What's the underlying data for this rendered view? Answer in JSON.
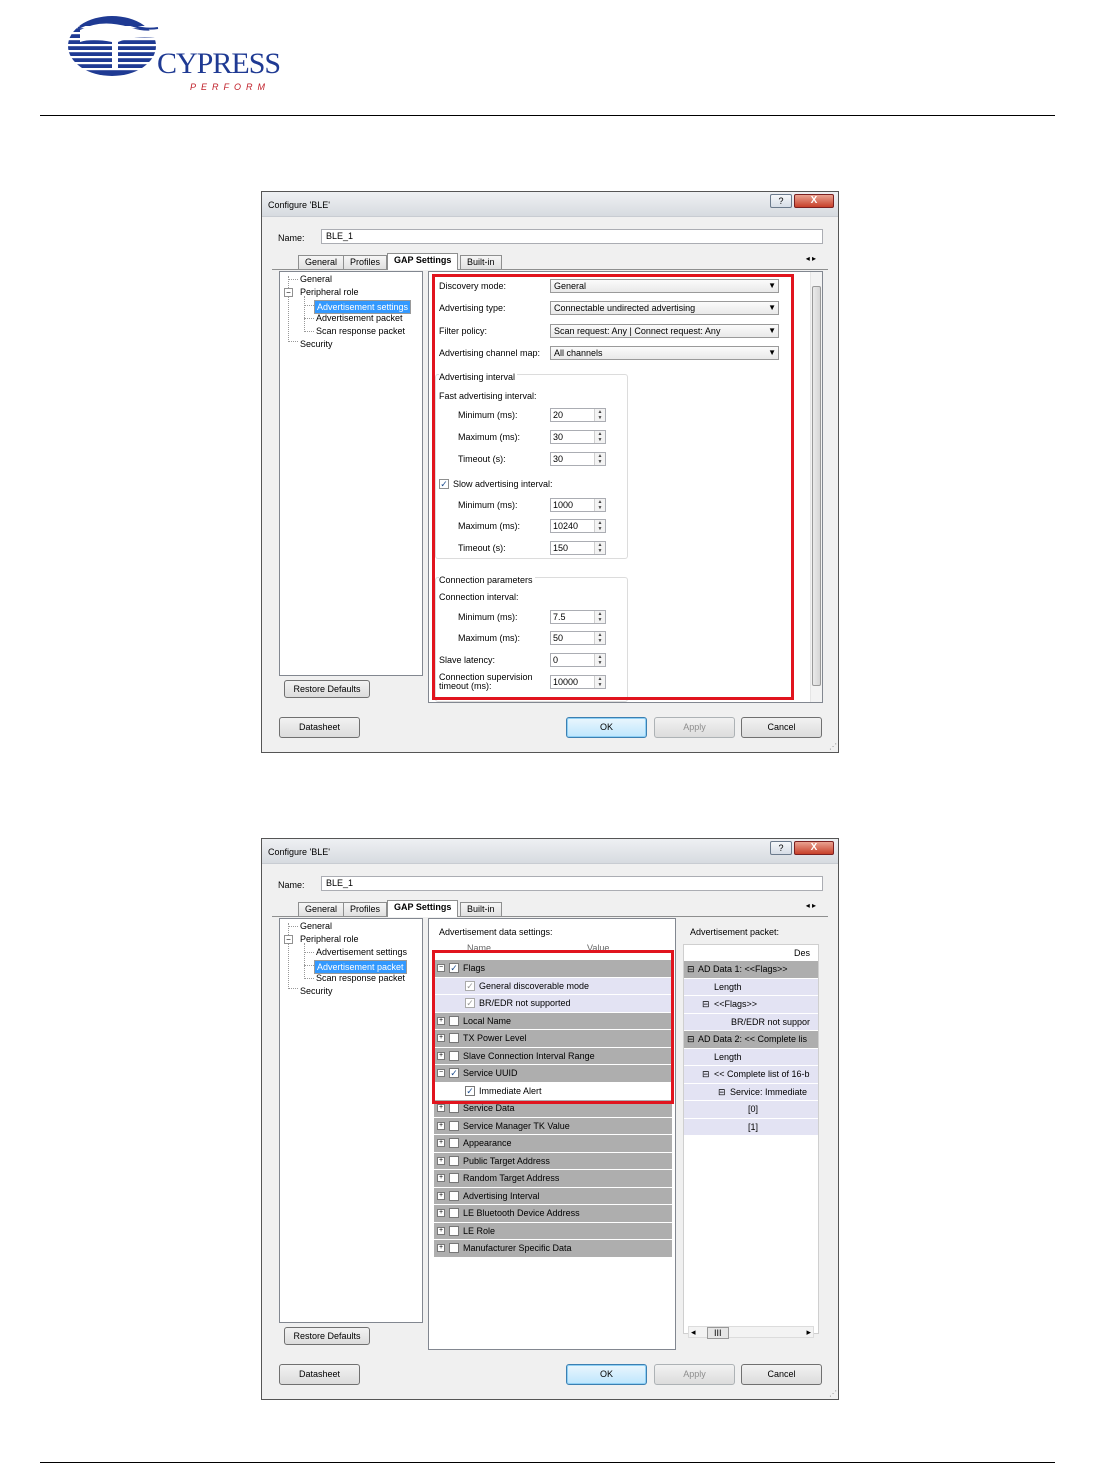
{
  "logo": {
    "name": "CYPRESS",
    "tagline": "PERFORM"
  },
  "dialog1": {
    "title": "Configure 'BLE'",
    "help_label": "?",
    "close_label": "X",
    "name_label": "Name:",
    "name_value": "BLE_1",
    "tabs": [
      "General",
      "Profiles",
      "GAP Settings",
      "Built-in"
    ],
    "tab_arrows": "◂ ▸",
    "tree": [
      "General",
      "Peripheral role",
      "Advertisement settings",
      "Advertisement packet",
      "Scan response packet",
      "Security"
    ],
    "fields": {
      "discovery_mode": {
        "label": "Discovery mode:",
        "value": "General"
      },
      "advertising_type": {
        "label": "Advertising type:",
        "value": "Connectable undirected advertising"
      },
      "filter_policy": {
        "label": "Filter policy:",
        "value": "Scan request: Any | Connect request: Any"
      },
      "channel_map": {
        "label": "Advertising channel map:",
        "value": "All channels"
      }
    },
    "adv_interval": {
      "group": "Advertising interval",
      "fast": "Fast advertising interval:",
      "fast_min": {
        "label": "Minimum (ms):",
        "value": "20"
      },
      "fast_max": {
        "label": "Maximum (ms):",
        "value": "30"
      },
      "fast_timeout": {
        "label": "Timeout (s):",
        "value": "30"
      },
      "slow": "Slow advertising interval:",
      "slow_checked": "✓",
      "slow_min": {
        "label": "Minimum (ms):",
        "value": "1000"
      },
      "slow_max": {
        "label": "Maximum (ms):",
        "value": "10240"
      },
      "slow_timeout": {
        "label": "Timeout (s):",
        "value": "150"
      }
    },
    "conn": {
      "group": "Connection parameters",
      "interval": "Connection interval:",
      "min": {
        "label": "Minimum (ms):",
        "value": "7.5"
      },
      "max": {
        "label": "Maximum (ms):",
        "value": "50"
      },
      "latency": {
        "label": "Slave latency:",
        "value": "0"
      },
      "timeout": {
        "label": "Connection supervision timeout (ms):",
        "value": "10000"
      }
    },
    "buttons": {
      "restore": "Restore Defaults",
      "datasheet": "Datasheet",
      "ok": "OK",
      "apply": "Apply",
      "cancel": "Cancel"
    }
  },
  "dialog2": {
    "title": "Configure 'BLE'",
    "help_label": "?",
    "close_label": "X",
    "name_label": "Name:",
    "name_value": "BLE_1",
    "tabs": [
      "General",
      "Profiles",
      "GAP Settings",
      "Built-in"
    ],
    "tab_arrows": "◂ ▸",
    "tree": [
      "General",
      "Peripheral role",
      "Advertisement settings",
      "Advertisement packet",
      "Scan response packet",
      "Security"
    ],
    "ad_settings_label": "Advertisement data settings:",
    "col_name": "Name",
    "col_value": "Value",
    "rows": [
      {
        "label": "Flags",
        "expander": "−",
        "checked": "✓"
      },
      {
        "label": "General discoverable mode",
        "checked": "✓"
      },
      {
        "label": "BR/EDR not supported",
        "checked": "✓"
      },
      {
        "label": "Local Name",
        "expander": "+",
        "checked": ""
      },
      {
        "label": "TX Power Level",
        "expander": "+",
        "checked": ""
      },
      {
        "label": "Slave Connection Interval Range",
        "expander": "+",
        "checked": ""
      },
      {
        "label": "Service UUID",
        "expander": "−",
        "checked": "✓"
      },
      {
        "label": "Immediate Alert",
        "checked": "✓"
      },
      {
        "label": "Service Data",
        "expander": "+",
        "checked": ""
      },
      {
        "label": "Service Manager TK Value",
        "expander": "+",
        "checked": ""
      },
      {
        "label": "Appearance",
        "expander": "+",
        "checked": ""
      },
      {
        "label": "Public Target Address",
        "expander": "+",
        "checked": ""
      },
      {
        "label": "Random Target Address",
        "expander": "+",
        "checked": ""
      },
      {
        "label": "Advertising Interval",
        "expander": "+",
        "checked": ""
      },
      {
        "label": "LE Bluetooth Device Address",
        "expander": "+",
        "checked": ""
      },
      {
        "label": "LE Role",
        "expander": "+",
        "checked": ""
      },
      {
        "label": "Manufacturer Specific Data",
        "expander": "+",
        "checked": ""
      }
    ],
    "packet_label": "Advertisement packet:",
    "packet_col": "Des",
    "packet_rows": [
      "AD Data 1: <<Flags>>",
      "Length",
      "<<Flags>>",
      "BR/EDR not suppor",
      "AD Data 2: << Complete lis",
      "Length",
      "<< Complete list of 16-b",
      "Service: Immediate",
      "[0]",
      "[1]"
    ],
    "hscroll_grip": "III",
    "buttons": {
      "restore": "Restore Defaults",
      "datasheet": "Datasheet",
      "ok": "OK",
      "apply": "Apply",
      "cancel": "Cancel"
    }
  }
}
